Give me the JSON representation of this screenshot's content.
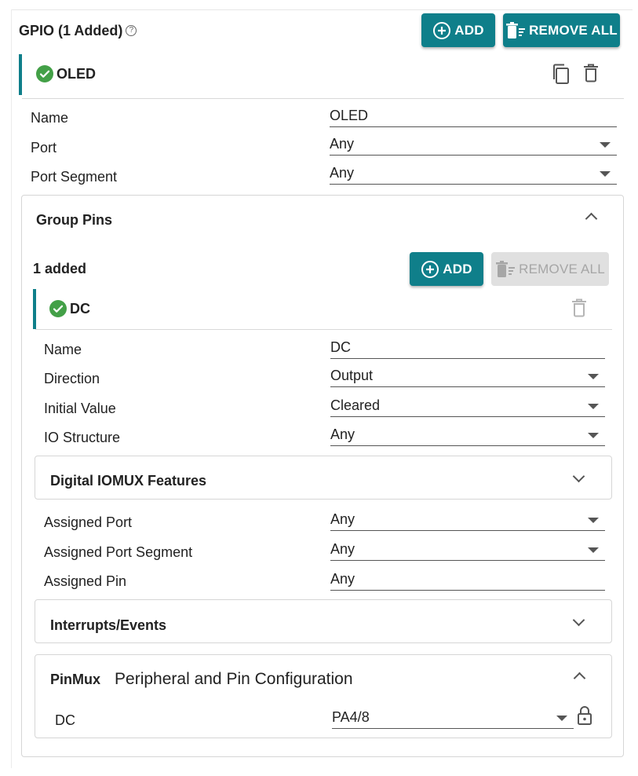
{
  "header": {
    "title": "GPIO (1 Added)",
    "help_icon": "help-circle-icon",
    "add_label": "ADD",
    "remove_all_label": "REMOVE ALL"
  },
  "gpio_item": {
    "name": "OLED",
    "status_icon": "check-circle-icon",
    "copy_icon": "copy-icon",
    "delete_icon": "trash-icon",
    "fields": {
      "name_label": "Name",
      "name_value": "OLED",
      "port_label": "Port",
      "port_value": "Any",
      "port_segment_label": "Port Segment",
      "port_segment_value": "Any"
    }
  },
  "group_pins": {
    "title": "Group Pins",
    "count_label": "1 added",
    "add_label": "ADD",
    "remove_all_label": "REMOVE ALL",
    "pin": {
      "name": "DC",
      "fields": {
        "name_label": "Name",
        "name_value": "DC",
        "direction_label": "Direction",
        "direction_value": "Output",
        "initial_value_label": "Initial Value",
        "initial_value_value": "Cleared",
        "io_structure_label": "IO Structure",
        "io_structure_value": "Any"
      },
      "digital_iomux": {
        "title": "Digital IOMUX Features"
      },
      "assigned": {
        "port_label": "Assigned Port",
        "port_value": "Any",
        "port_segment_label": "Assigned Port Segment",
        "port_segment_value": "Any",
        "pin_label": "Assigned Pin",
        "pin_value": "Any"
      },
      "interrupts": {
        "title": "Interrupts/Events"
      },
      "pinmux": {
        "title_bold": "PinMux",
        "title": "Peripheral and Pin Configuration",
        "row_label": "DC",
        "row_value": "PA4/8",
        "lock_icon": "lock-icon"
      }
    }
  },
  "colors": {
    "accent": "#0f7f8a",
    "success": "#43a047",
    "disabled_bg": "#e0e0e0",
    "disabled_text": "#a6a6a6"
  }
}
